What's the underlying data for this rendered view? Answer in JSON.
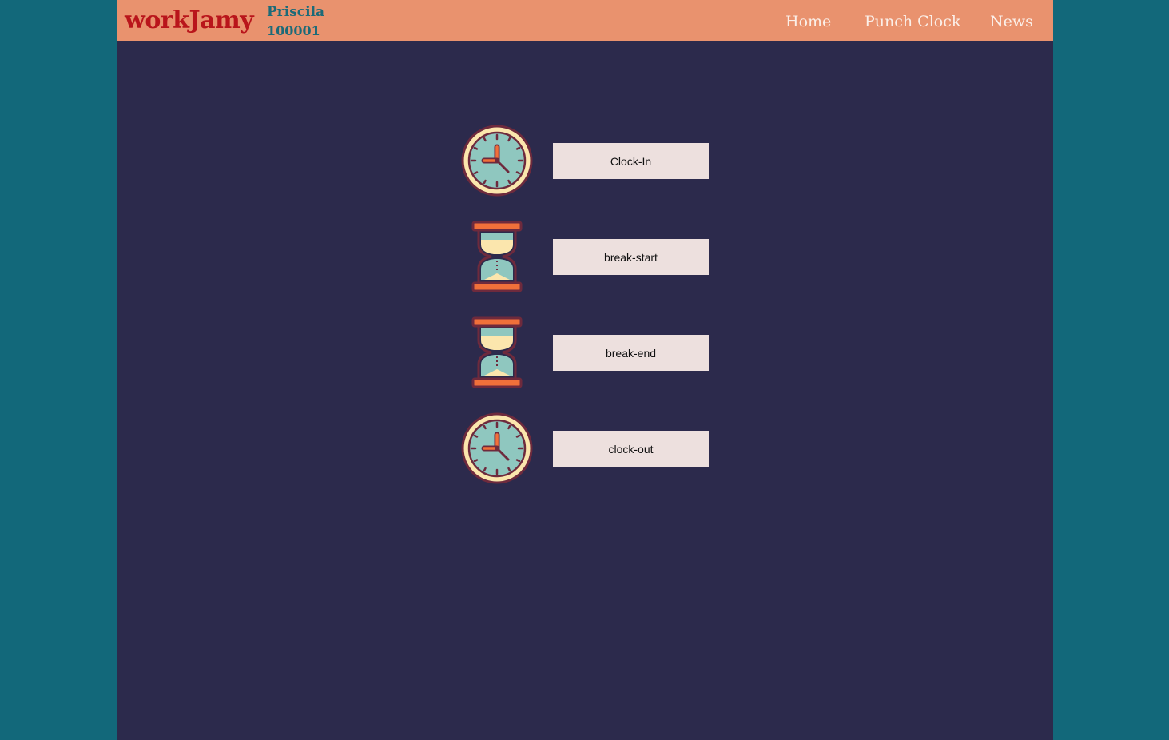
{
  "header": {
    "logo": "workJamy",
    "user_name": "Priscila",
    "user_id": "100001",
    "nav": {
      "home": "Home",
      "punch_clock": "Punch Clock",
      "news": "News"
    }
  },
  "actions": {
    "clock_in": {
      "label": "Clock-In",
      "icon": "clock-icon"
    },
    "break_start": {
      "label": "break-start",
      "icon": "hourglass-icon"
    },
    "break_end": {
      "label": "break-end",
      "icon": "hourglass-icon"
    },
    "clock_out": {
      "label": "clock-out",
      "icon": "clock-icon"
    }
  },
  "colors": {
    "page_background": "#12687a",
    "app_background": "#2c2a4c",
    "header_background": "#e9926e",
    "logo": "#b9151b",
    "user_text": "#1c6a78",
    "nav_text": "#fbefe8",
    "button_background": "#ede0de"
  }
}
